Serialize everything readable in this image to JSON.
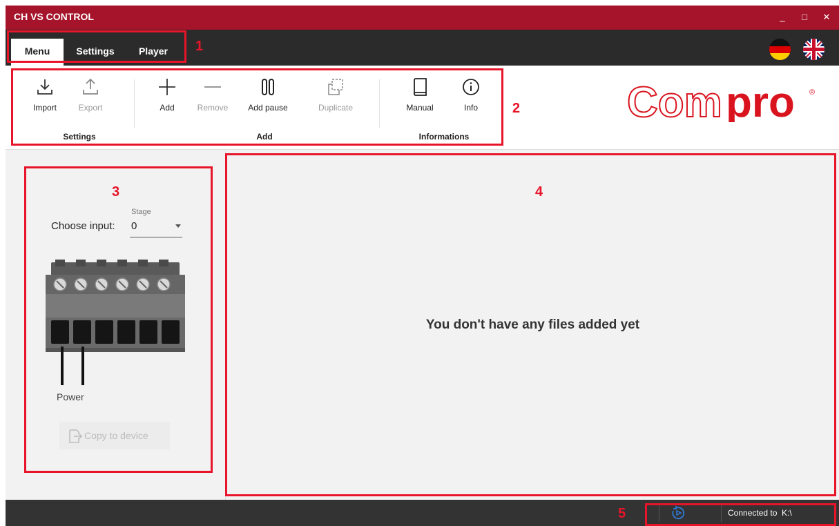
{
  "window": {
    "title": "CH VS CONTROL",
    "minimize": "_",
    "maximize": "□",
    "close": "✕"
  },
  "menu": {
    "tabs": [
      {
        "label": "Menu"
      },
      {
        "label": "Settings"
      },
      {
        "label": "Player"
      }
    ],
    "active_tab": "Menu"
  },
  "languages": [
    {
      "icon": "flag-germany-icon"
    },
    {
      "icon": "flag-uk-icon"
    }
  ],
  "toolbar": {
    "groups": [
      {
        "label": "Settings",
        "buttons": [
          {
            "label": "Import",
            "icon": "import-icon",
            "enabled": true
          },
          {
            "label": "Export",
            "icon": "export-icon",
            "enabled": false
          }
        ]
      },
      {
        "label": "Add",
        "buttons": [
          {
            "label": "Add",
            "icon": "plus-icon",
            "enabled": true
          },
          {
            "label": "Remove",
            "icon": "minus-icon",
            "enabled": false
          },
          {
            "label": "Add pause",
            "icon": "pause-icon",
            "enabled": true
          },
          {
            "label": "Duplicate",
            "icon": "duplicate-icon",
            "enabled": false
          }
        ]
      },
      {
        "label": "Informations",
        "buttons": [
          {
            "label": "Manual",
            "icon": "book-icon",
            "enabled": true
          },
          {
            "label": "Info",
            "icon": "info-icon",
            "enabled": true
          }
        ]
      }
    ]
  },
  "logo": {
    "text_outline": "Com",
    "text_bold": "pro",
    "mark": "®"
  },
  "left_panel": {
    "input_label": "Choose input:",
    "dropdown_floating_label": "Stage",
    "dropdown_value": "0",
    "power_label": "Power",
    "copy_button": "Copy to device",
    "copy_enabled": false
  },
  "main": {
    "empty_message": "You don't have any files added yet"
  },
  "status_bar": {
    "connection_label": "Connected to",
    "drive": "K:\\",
    "status": "Connected to  K:\\",
    "refresh_icon": "refresh-play-icon"
  },
  "annotations": [
    "1",
    "2",
    "3",
    "4",
    "5"
  ],
  "colors": {
    "titlebar": "#a5142a",
    "menubar": "#2b2b2b",
    "annotation": "#e8142a",
    "logo_red": "#d9141f"
  }
}
